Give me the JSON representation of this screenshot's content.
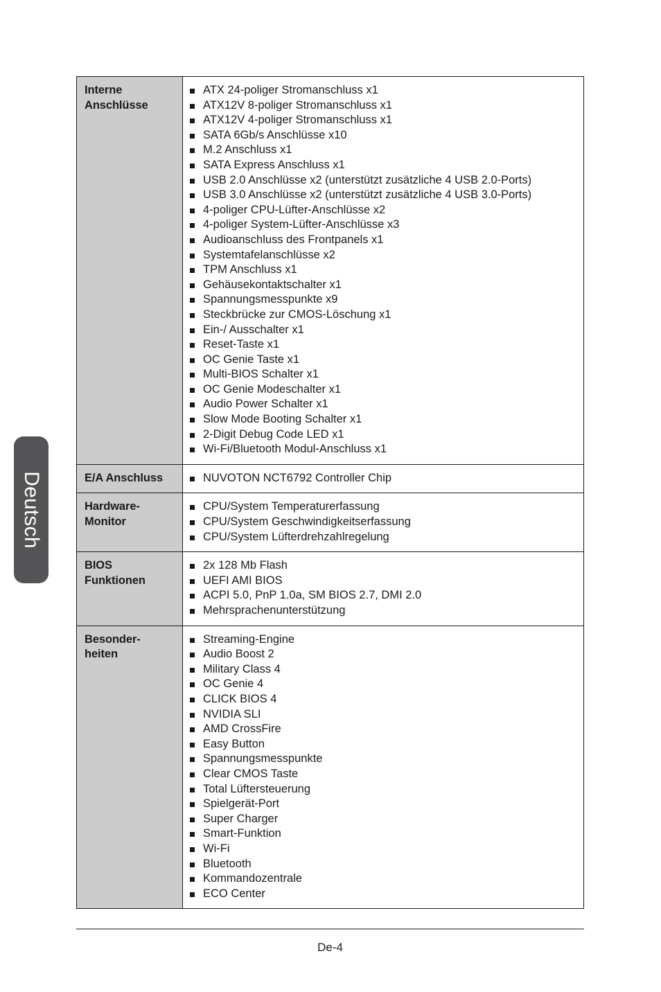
{
  "page": {
    "language_tab": "Deutsch",
    "footer_page_number": "De-4",
    "accent_tab_color": "#545456",
    "label_column_color": "#cccccc",
    "border_color": "#1a1a1a"
  },
  "spec_table": {
    "rows": [
      {
        "label_lines": [
          "Interne",
          "Anschlüsse"
        ],
        "items": [
          "ATX 24-poliger Stromanschluss x1",
          "ATX12V 8-poliger Stromanschluss x1",
          "ATX12V 4-poliger Stromanschluss x1",
          "SATA 6Gb/s Anschlüsse x10",
          "M.2 Anschluss x1",
          "SATA Express Anschluss x1",
          "USB 2.0 Anschlüsse x2 (unterstützt zusätzliche 4 USB 2.0-Ports)",
          "USB 3.0 Anschlüsse x2 (unterstützt zusätzliche 4 USB 3.0-Ports)",
          "4-poliger CPU-Lüfter-Anschlüsse x2",
          "4-poliger System-Lüfter-Anschlüsse x3",
          "Audioanschluss des Frontpanels x1",
          "Systemtafelanschlüsse x2",
          "TPM Anschluss x1",
          "Gehäusekontaktschalter x1",
          "Spannungsmesspunkte x9",
          "Steckbrücke zur CMOS-Löschung x1",
          "Ein-/ Ausschalter x1",
          "Reset-Taste x1",
          "OC Genie Taste x1",
          "Multi-BIOS Schalter x1",
          "OC Genie Modeschalter x1",
          "Audio Power Schalter x1",
          "Slow Mode Booting Schalter x1",
          "2-Digit Debug Code LED x1",
          "Wi-Fi/Bluetooth Modul-Anschluss x1"
        ]
      },
      {
        "label_lines": [
          "E/A Anschluss"
        ],
        "items": [
          "NUVOTON NCT6792 Controller Chip"
        ]
      },
      {
        "label_lines": [
          "Hardware-",
          "Monitor"
        ],
        "items": [
          "CPU/System Temperaturerfassung",
          "CPU/System Geschwindigkeitserfassung",
          "CPU/System Lüfterdrehzahlregelung"
        ]
      },
      {
        "label_lines": [
          "BIOS",
          "Funktionen"
        ],
        "items": [
          "2x 128 Mb Flash",
          "UEFI AMI BIOS",
          "ACPI 5.0, PnP 1.0a, SM BIOS 2.7, DMI 2.0",
          "Mehrsprachenunterstützung"
        ]
      },
      {
        "label_lines": [
          "Besonder-",
          "heiten"
        ],
        "items": [
          "Streaming-Engine",
          "Audio Boost 2",
          "Military Class 4",
          "OC Genie 4",
          "CLICK BIOS 4",
          "NVIDIA SLI",
          "AMD CrossFire",
          "Easy Button",
          "Spannungsmesspunkte",
          "Clear CMOS Taste",
          "Total Lüftersteuerung",
          "Spielgerät-Port",
          "Super Charger",
          "Smart-Funktion",
          "Wi-Fi",
          "Bluetooth",
          "Kommandozentrale",
          "ECO Center"
        ]
      }
    ]
  }
}
